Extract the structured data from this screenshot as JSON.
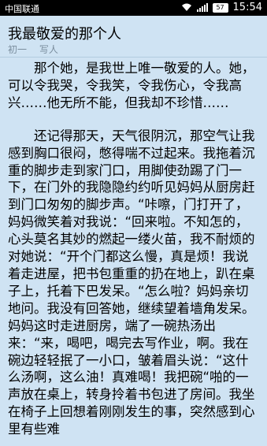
{
  "statusbar": {
    "carrier": "中国联通",
    "battery": "57",
    "time": "15:54"
  },
  "article": {
    "title": "我最敬爱的那个人",
    "grade": "初一",
    "category": "写人",
    "paragraphs": [
      "那个她，是我世上唯一敬爱的人。她，可以令我哭，令我笑，令我伤心，令我高兴……他无所不能，但我却不珍惜……",
      "还记得那天，天气很阴沉，那空气让我感到胸口很闷，憋得喘不过起来。我拖着沉重的脚步走到家门口，用脚使劲踢了门一下，在门外的我隐隐约约听见妈妈从厨房赶到门口匆匆的脚步声。“咔嚓，门打开了，妈妈微笑着对我说：“回来啦。不知怎的，心头莫名其妙的燃起一缕火苗，我不耐烦的对她说：“开个门都这么慢，真是烦！我说着走进屋，把书包重重的扔在地上，趴在桌子上，托着下巴发呆。“怎么啦？妈妈亲切地问。我没有回答她，继续望着墙角发呆。妈妈这时走进厨房，端了一碗热汤出来：“来，喝吧，喝完去写作业，啊。我在碗边轻轻抿了一小口，皱着眉头说：“这什么汤啊，这么油！真难喝！我把碗“啪的一声放在桌上，转身拎着书包进了房间。我坐在椅子上回想着刚刚发生的事，突然感到心里有些难"
    ]
  }
}
